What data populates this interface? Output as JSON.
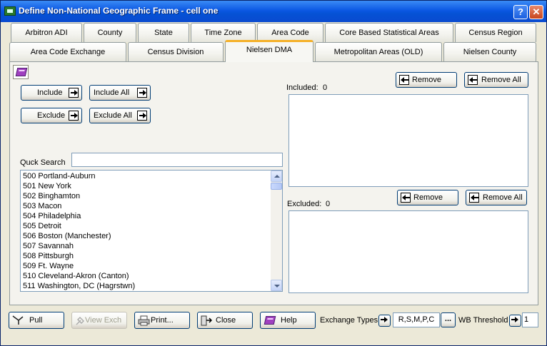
{
  "window": {
    "title": "Define Non-National Geographic Frame - cell one",
    "help_label": "?",
    "close_label": "✕"
  },
  "tabs_row1": [
    "Arbitron ADI",
    "County",
    "State",
    "Time Zone",
    "Area Code",
    "Core Based Statistical Areas",
    "Census Region"
  ],
  "tabs_row2": [
    "Area Code Exchange",
    "Census Division",
    "Nielsen DMA",
    "Metropolitan Areas (OLD)",
    "Nielsen County"
  ],
  "active_tab": "Nielsen DMA",
  "actions": {
    "include": "Include",
    "include_all": "Include All",
    "exclude": "Exclude",
    "exclude_all": "Exclude All"
  },
  "search": {
    "label": "Quck Search",
    "value": ""
  },
  "dma_list": [
    "500 Portland-Auburn",
    "501 New York",
    "502 Binghamton",
    "503 Macon",
    "504 Philadelphia",
    "505 Detroit",
    "506 Boston (Manchester)",
    "507 Savannah",
    "508 Pittsburgh",
    "509 Ft. Wayne",
    "510 Cleveland-Akron (Canton)",
    "511 Washington, DC (Hagrstwn)"
  ],
  "included": {
    "label": "Included:",
    "count": "0",
    "remove": "Remove",
    "remove_all": "Remove All"
  },
  "excluded": {
    "label": "Excluded:",
    "count": "0",
    "remove": "Remove",
    "remove_all": "Remove All"
  },
  "footer": {
    "pull": "Pull",
    "view_exch": "View Exch",
    "print": "Print...",
    "close": "Close",
    "help": "Help",
    "exchange_types_label": "Exchange Types",
    "exchange_types_value": "R,S,M,P,C",
    "ellipsis": "...",
    "wb_threshold_label": "WB Threshold",
    "wb_threshold_value": "1"
  },
  "colors": {
    "accent_tab": "#f5b027",
    "title_bar": "#0c58e3",
    "dialog_bg": "#ece9d8"
  }
}
